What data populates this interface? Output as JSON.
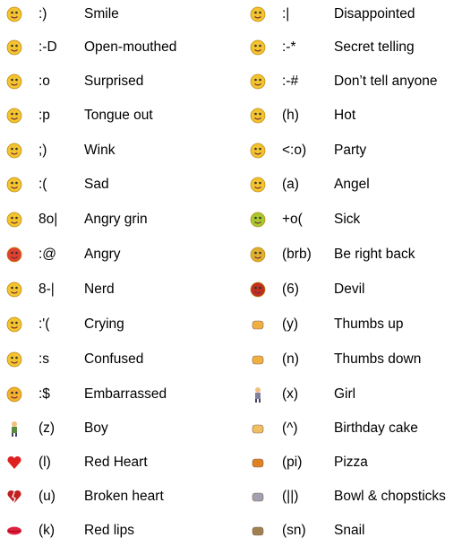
{
  "left": [
    {
      "icon": "smile-icon",
      "code": ":)",
      "name": "Smile",
      "color": "#f4c430"
    },
    {
      "icon": "open-mouthed-icon",
      "code": ":-D",
      "name": "Open-mouthed",
      "color": "#f4c430"
    },
    {
      "icon": "surprised-icon",
      "code": ":o",
      "name": "Surprised",
      "color": "#f4c430"
    },
    {
      "icon": "tongue-out-icon",
      "code": ":p",
      "name": "Tongue out",
      "color": "#f4c430"
    },
    {
      "icon": "wink-icon",
      "code": ";)",
      "name": "Wink",
      "color": "#f4c430"
    },
    {
      "icon": "sad-icon",
      "code": ":(",
      "name": "Sad",
      "color": "#f4c430"
    },
    {
      "icon": "angry-grin-icon",
      "code": "8o|",
      "name": "Angry grin",
      "color": "#f4c430"
    },
    {
      "icon": "angry-icon",
      "code": ":@",
      "name": "Angry",
      "color": "#e04030"
    },
    {
      "icon": "nerd-icon",
      "code": "8-|",
      "name": "Nerd",
      "color": "#f4c430"
    },
    {
      "icon": "crying-icon",
      "code": ":'(",
      "name": "Crying",
      "color": "#f4c430"
    },
    {
      "icon": "confused-icon",
      "code": ":s",
      "name": "Confused",
      "color": "#f4c430"
    },
    {
      "icon": "embarrassed-icon",
      "code": ":$",
      "name": "Embarrassed",
      "color": "#f4b030"
    },
    {
      "icon": "boy-icon",
      "code": "(z)",
      "name": "Boy",
      "color": "#5a8a40"
    },
    {
      "icon": "red-heart-icon",
      "code": "(l)",
      "name": "Red Heart",
      "color": "#e02020"
    },
    {
      "icon": "broken-heart-icon",
      "code": "(u)",
      "name": "Broken heart",
      "color": "#c02020"
    },
    {
      "icon": "red-lips-icon",
      "code": "(k)",
      "name": "Red lips",
      "color": "#e02040"
    }
  ],
  "right": [
    {
      "icon": "disappointed-icon",
      "code": ":|",
      "name": "Disappointed",
      "color": "#f4c430"
    },
    {
      "icon": "secret-telling-icon",
      "code": ":-*",
      "name": "Secret telling",
      "color": "#f4c430"
    },
    {
      "icon": "dont-tell-anyone-icon",
      "code": ":-#",
      "name": "Don’t tell anyone",
      "color": "#f4c430"
    },
    {
      "icon": "hot-icon",
      "code": "(h)",
      "name": "Hot",
      "color": "#f4c430"
    },
    {
      "icon": "party-icon",
      "code": "<:o)",
      "name": "Party",
      "color": "#f4c430"
    },
    {
      "icon": "angel-icon",
      "code": "(a)",
      "name": "Angel",
      "color": "#f4c430"
    },
    {
      "icon": "sick-icon",
      "code": "+o(",
      "name": "Sick",
      "color": "#a8c830"
    },
    {
      "icon": "be-right-back-icon",
      "code": "(brb)",
      "name": "Be right back",
      "color": "#e0b030"
    },
    {
      "icon": "devil-icon",
      "code": "(6)",
      "name": "Devil",
      "color": "#c03020"
    },
    {
      "icon": "thumbs-up-icon",
      "code": "(y)",
      "name": "Thumbs up",
      "color": "#f0b040"
    },
    {
      "icon": "thumbs-down-icon",
      "code": "(n)",
      "name": "Thumbs down",
      "color": "#f0b040"
    },
    {
      "icon": "girl-icon",
      "code": "(x)",
      "name": "Girl",
      "color": "#8080a0"
    },
    {
      "icon": "birthday-cake-icon",
      "code": "(^)",
      "name": "Birthday cake",
      "color": "#f0c060"
    },
    {
      "icon": "pizza-icon",
      "code": "(pi)",
      "name": "Pizza",
      "color": "#e08020"
    },
    {
      "icon": "bowl-chopsticks-icon",
      "code": "(||)",
      "name": "Bowl & chopsticks",
      "color": "#a0a0b0"
    },
    {
      "icon": "snail-icon",
      "code": "(sn)",
      "name": "Snail",
      "color": "#a08050"
    }
  ]
}
